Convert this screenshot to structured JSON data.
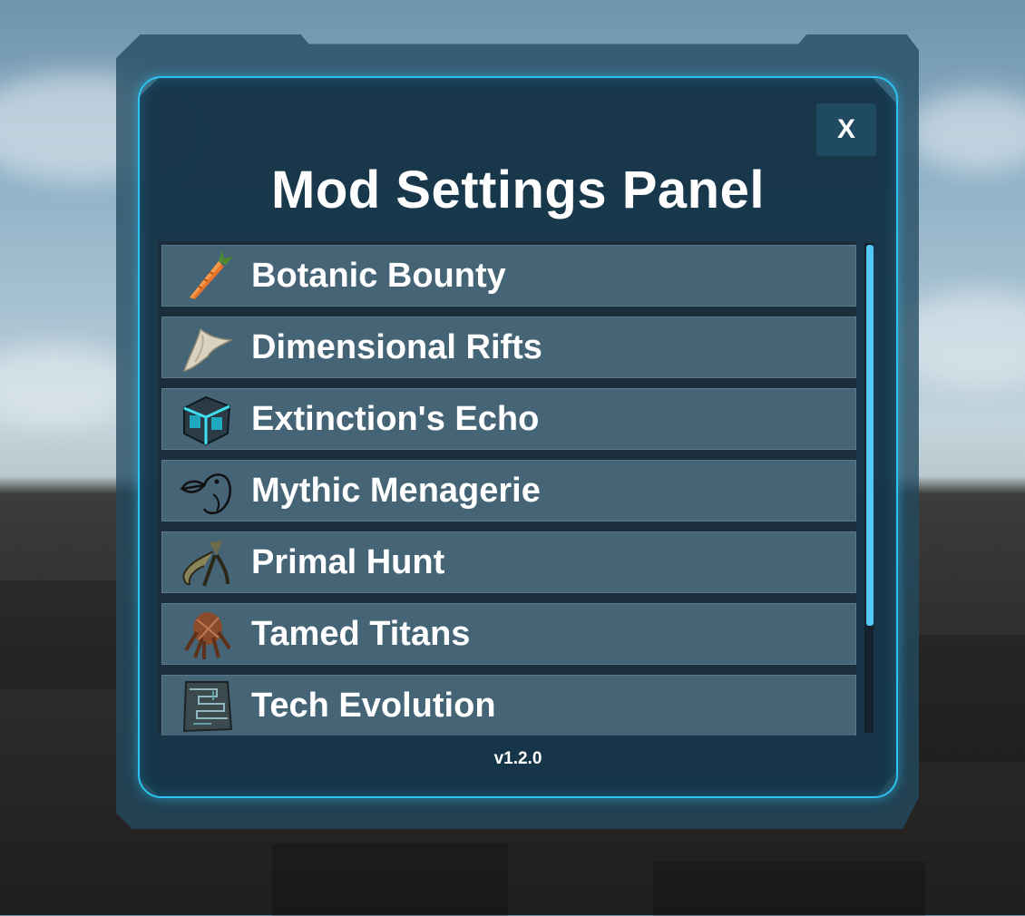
{
  "panel": {
    "title": "Mod Settings Panel",
    "close_label": "X",
    "version": "v1.2.0"
  },
  "mods": [
    {
      "label": "Botanic Bounty",
      "icon": "carrot-icon"
    },
    {
      "label": "Dimensional Rifts",
      "icon": "tooth-icon"
    },
    {
      "label": "Extinction's Echo",
      "icon": "glowing-cube-icon"
    },
    {
      "label": "Mythic Menagerie",
      "icon": "dodo-icon"
    },
    {
      "label": "Primal Hunt",
      "icon": "claw-icon"
    },
    {
      "label": "Tamed Titans",
      "icon": "creature-icon"
    },
    {
      "label": "Tech Evolution",
      "icon": "circuit-plate-icon"
    }
  ],
  "colors": {
    "accent": "#2cc3f0",
    "row_bg": "#456476",
    "scroll_thumb": "#54c8f5"
  }
}
